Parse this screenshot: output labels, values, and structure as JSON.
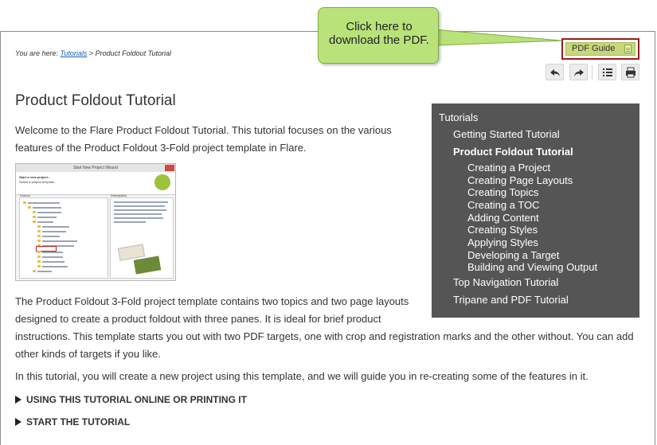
{
  "callout": {
    "text": "Click here to\ndownload the PDF."
  },
  "pdf_guide": {
    "label": "PDF Guide"
  },
  "breadcrumb": {
    "prefix": "You are here: ",
    "link": "Tutorials",
    "separator": " > ",
    "current": "Product Foldout Tutorial"
  },
  "toolbar": {
    "buttons": [
      "back-icon",
      "forward-icon",
      "list-icon",
      "print-icon"
    ]
  },
  "page": {
    "title": "Product Foldout Tutorial",
    "intro_line1": "Welcome to the Flare Product Foldout Tutorial. This tutorial focuses on the various",
    "intro_line2": "features of the Product Foldout 3-Fold project template in Flare.",
    "body_line1": "The Product Foldout 3-Fold project template contains two topics and two page layouts",
    "body_line2": "designed to create a product foldout with three panes. It is ideal for brief product",
    "body_line3": "instructions. This template starts you out with two PDF targets, one with crop and registration marks and the other without. You can add",
    "body_line4": "other kinds of targets if you like.",
    "body_para2": "In this tutorial, you will create a new project using this template, and we will guide you in re-creating some of the features in it.",
    "toggler1": "USING THIS TUTORIAL ONLINE OR PRINTING IT",
    "toggler2": "START THE TUTORIAL"
  },
  "screenshot": {
    "window_title": "Start New Project Wizard",
    "header_line1": "Start a new project...",
    "header_line2": "Select a project template...",
    "source_label": "Source",
    "description_label": "Description"
  },
  "toc": {
    "items": [
      {
        "label": "Tutorials",
        "level": 0
      },
      {
        "label": "Getting Started Tutorial",
        "level": 1
      },
      {
        "label": "Product Foldout Tutorial",
        "level": 1,
        "current": true
      },
      {
        "label": "Creating a Project",
        "level": 2
      },
      {
        "label": "Creating Page Layouts",
        "level": 2
      },
      {
        "label": "Creating Topics",
        "level": 2
      },
      {
        "label": "Creating a TOC",
        "level": 2
      },
      {
        "label": "Adding Content",
        "level": 2
      },
      {
        "label": "Creating Styles",
        "level": 2
      },
      {
        "label": "Applying Styles",
        "level": 2
      },
      {
        "label": "Developing a Target",
        "level": 2
      },
      {
        "label": "Building and Viewing Output",
        "level": 2
      },
      {
        "label": "Top Navigation Tutorial",
        "level": 1
      },
      {
        "label": "Tripane and PDF Tutorial",
        "level": 1
      }
    ]
  },
  "colors": {
    "callout_fill": "#b9e27b",
    "pdf_button_fill": "#c7d77a",
    "highlight_border": "#9b1c1c",
    "toc_background": "#555555",
    "link": "#1a5fb4"
  }
}
